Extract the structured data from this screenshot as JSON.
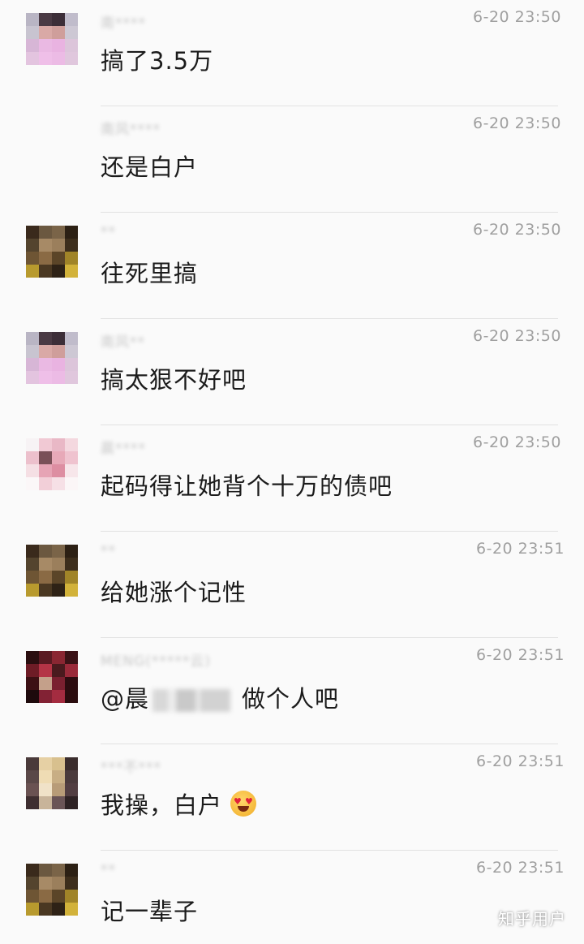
{
  "messages": [
    {
      "sender": "南****",
      "time": "6-20 23:50",
      "text": "搞了3.5万",
      "avatar": "avatar-pink-person",
      "has_avatar": true
    },
    {
      "sender": "南风****",
      "time": "6-20 23:50",
      "text": "还是白户",
      "avatar": "none",
      "has_avatar": false
    },
    {
      "sender": "**",
      "time": "6-20 23:50",
      "text": "往死里搞",
      "avatar": "avatar-dark-photo",
      "has_avatar": true
    },
    {
      "sender": "南风**",
      "time": "6-20 23:50",
      "text": "搞太狠不好吧",
      "avatar": "avatar-pink-person",
      "has_avatar": true
    },
    {
      "sender": "晨****",
      "time": "6-20 23:50",
      "text": "起码得让她背个十万的债吧",
      "avatar": "avatar-pink-pig",
      "has_avatar": true
    },
    {
      "sender": "**",
      "time": "6-20 23:51",
      "text": "给她涨个记性",
      "avatar": "avatar-dark-photo",
      "has_avatar": true
    },
    {
      "sender": "MENG(*****云)",
      "time": "6-20 23:51",
      "text_prefix": "@晨",
      "text_suffix": "做个人吧",
      "avatar": "avatar-red-photo",
      "has_avatar": true
    },
    {
      "sender": "***不***",
      "time": "6-20 23:51",
      "text": "我操，白户",
      "avatar": "avatar-blonde-photo",
      "has_avatar": true,
      "emoji": "heart-eyes-emoji"
    },
    {
      "sender": "**",
      "time": "6-20 23:51",
      "text": "记一辈子",
      "avatar": "avatar-dark-photo",
      "has_avatar": true
    }
  ],
  "watermark": "知乎用户"
}
